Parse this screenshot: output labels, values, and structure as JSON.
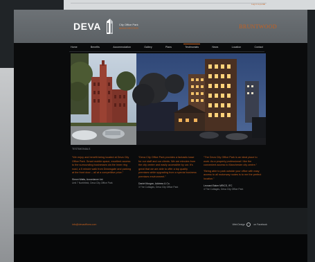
{
  "top_bar": {
    "link": "Log in to portal"
  },
  "header": {
    "logo_text": "DEVA",
    "logo_sub_1": "City Office Park",
    "logo_sub_2": "MANCHESTER",
    "partner_logo": "BRUNTWOOD",
    "colors": {
      "accent": "#c9611d",
      "header_bg": "#62676b",
      "site_bg": "#0a0b0c"
    }
  },
  "nav": {
    "items": [
      "Home",
      "Benefits",
      "Accommodation",
      "Gallery",
      "Plans",
      "Testimonials",
      "News",
      "Location",
      "Contact"
    ],
    "active": "Testimonials"
  },
  "hero": {
    "icon": "hero-photo"
  },
  "testimonials": {
    "section_label": "TESTIMONIALS",
    "items": [
      {
        "quote": "“We enjoy and benefit being located at Deva City Office Park. Smart mobile space, excellent access to the surrounding businesses via the inner ring road, a 5 minute walk from Deansgate and parking at the front door – all at a competitive price.”",
        "author": "Simon Watts, Accordance Ltd.",
        "role": "Unit 7 Northfield, Deva City Office Park"
      },
      {
        "quote": "“Deva City Office Park provides a fantastic base for our staff and our clients. We are minutes from the city centre and easily accessible by car. It's great that we are able to offer a top quality premises while upgrading from a special business premises environment.”",
        "author": "Daniel Morgan, Address & Co.",
        "role": "3 The Cottages, Deva City Office Park"
      },
      {
        "quote": "“The Deva City Office Park is an ideal place to work. As a property professional I like the convenient access to Manchester city centre.”",
        "quote_2": "“Being able to park outside your office with easy access to all motorway routes is to me the perfect location.”",
        "author": "Leonard Baker MRICS, IFC",
        "role": "4 The Cottages, Deva City Office Park"
      }
    ]
  },
  "footer": {
    "email": "info@devaoffices.com",
    "credit": "Web Design",
    "social": "on Facebook"
  }
}
